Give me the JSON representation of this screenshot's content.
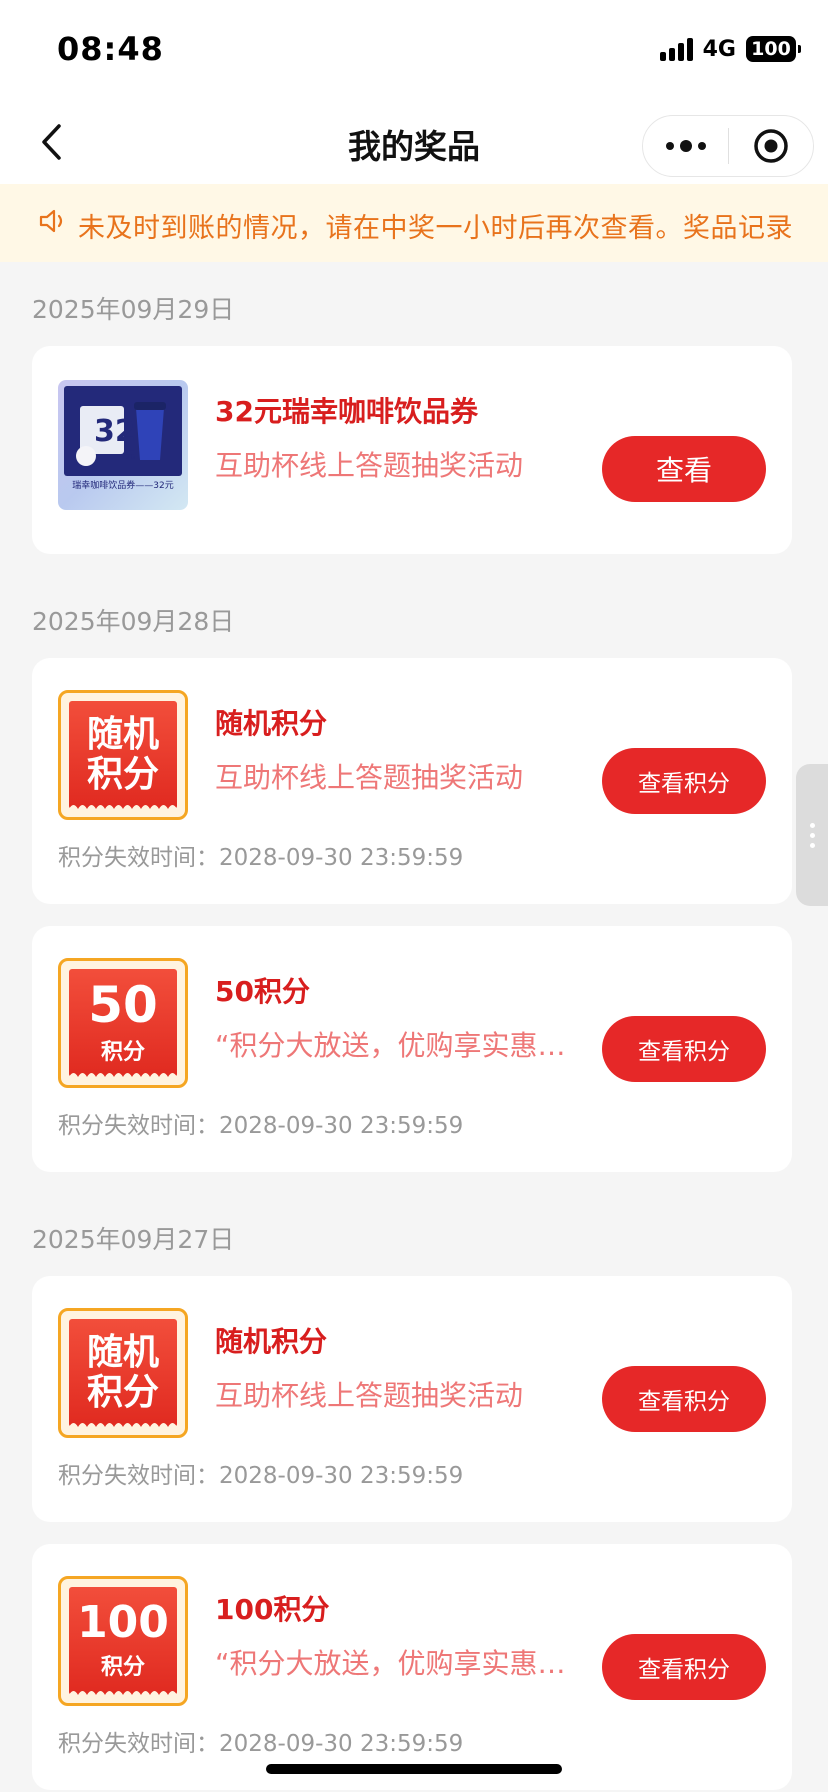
{
  "status_bar": {
    "time": "08:48",
    "network": "4G",
    "battery": "100"
  },
  "nav": {
    "title": "我的奖品",
    "back_icon": "chevron-left-icon",
    "more_icon": "more-dots-icon",
    "close_icon": "target-circle-icon"
  },
  "notice": {
    "icon": "speaker-icon",
    "text": "未及时到账的情况，请在中奖一小时后再次查看。奖品记录"
  },
  "groups": [
    {
      "date": "2025年09月29日"
    },
    {
      "date": "2025年09月28日"
    },
    {
      "date": "2025年09月27日"
    }
  ],
  "prizes": [
    {
      "thumb_type": "coupon",
      "coupon_value": "32",
      "coupon_unit": "元",
      "coupon_label": "瑞幸咖啡饮品券——32元",
      "title": "32元瑞幸咖啡饮品券",
      "subtitle": "互助杯线上答题抽奖活动",
      "button": "查看"
    },
    {
      "thumb_type": "random",
      "badge_line1": "随机",
      "badge_line2": "积分",
      "title": "随机积分",
      "subtitle": "互助杯线上答题抽奖活动",
      "button": "查看积分",
      "expire_label": "积分失效时间：",
      "expire_value": "2028-09-30 23:59:59"
    },
    {
      "thumb_type": "points",
      "badge_number": "50",
      "badge_unit": "积分",
      "title": "50积分",
      "subtitle": "“积分大放送，优购享实惠…",
      "button": "查看积分",
      "expire_label": "积分失效时间：",
      "expire_value": "2028-09-30 23:59:59"
    },
    {
      "thumb_type": "random",
      "badge_line1": "随机",
      "badge_line2": "积分",
      "title": "随机积分",
      "subtitle": "互助杯线上答题抽奖活动",
      "button": "查看积分",
      "expire_label": "积分失效时间：",
      "expire_value": "2028-09-30 23:59:59"
    },
    {
      "thumb_type": "points",
      "badge_number": "100",
      "badge_unit": "积分",
      "title": "100积分",
      "subtitle": "“积分大放送，优购享实惠…",
      "button": "查看积分",
      "expire_label": "积分失效时间：",
      "expire_value": "2028-09-30 23:59:59"
    }
  ],
  "colors": {
    "accent": "#e62828",
    "title_red": "#d81e1e",
    "sub_red": "#ee7777",
    "notice_orange": "#e8731c",
    "notice_bg": "#fff8e6"
  }
}
